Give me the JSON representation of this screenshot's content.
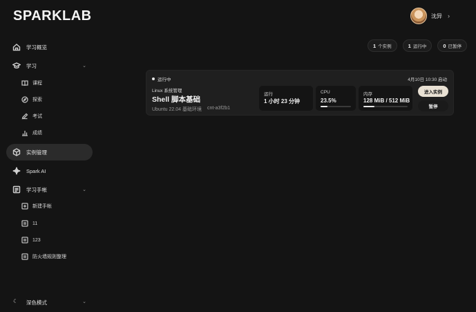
{
  "brand": "SPARKLAB",
  "user": {
    "name": "沈异"
  },
  "nav": {
    "overview": "学习概览",
    "study": "学习",
    "study_sub": [
      "课程",
      "探索",
      "考试",
      "成绩"
    ],
    "instances": "实例管理",
    "spark_ai": "Spark AI",
    "notebook": "学习手帐",
    "notebook_sub": [
      "新建手帐",
      "11",
      "123",
      "防火墙规则整理"
    ],
    "theme": "深色模式"
  },
  "stats": [
    {
      "count": "1",
      "label": "个实例"
    },
    {
      "count": "1",
      "label": "运行中"
    },
    {
      "count": "0",
      "label": "已暂停"
    }
  ],
  "instance": {
    "status": "运行中",
    "started": "4月10日 10:30 启动",
    "course": "Linux 系统管理",
    "title": "Shell 脚本基础",
    "env": "Ubuntu 22.04 基础环境",
    "id": "cnt-a3f2b1",
    "metrics": {
      "runtime": {
        "label": "运行",
        "value": "1 小时 23 分钟"
      },
      "cpu": {
        "label": "CPU",
        "value": "23.5%",
        "fraction": 0.235
      },
      "memory": {
        "label": "内存",
        "value": "128 MiB / 512 MiB",
        "fraction": 0.25
      }
    },
    "enter_label": "进入实例",
    "pause_label": "暂停"
  },
  "colors": {
    "background": "#141414",
    "card": "#1f1f1f",
    "accent_button": "#e9e1d4"
  }
}
